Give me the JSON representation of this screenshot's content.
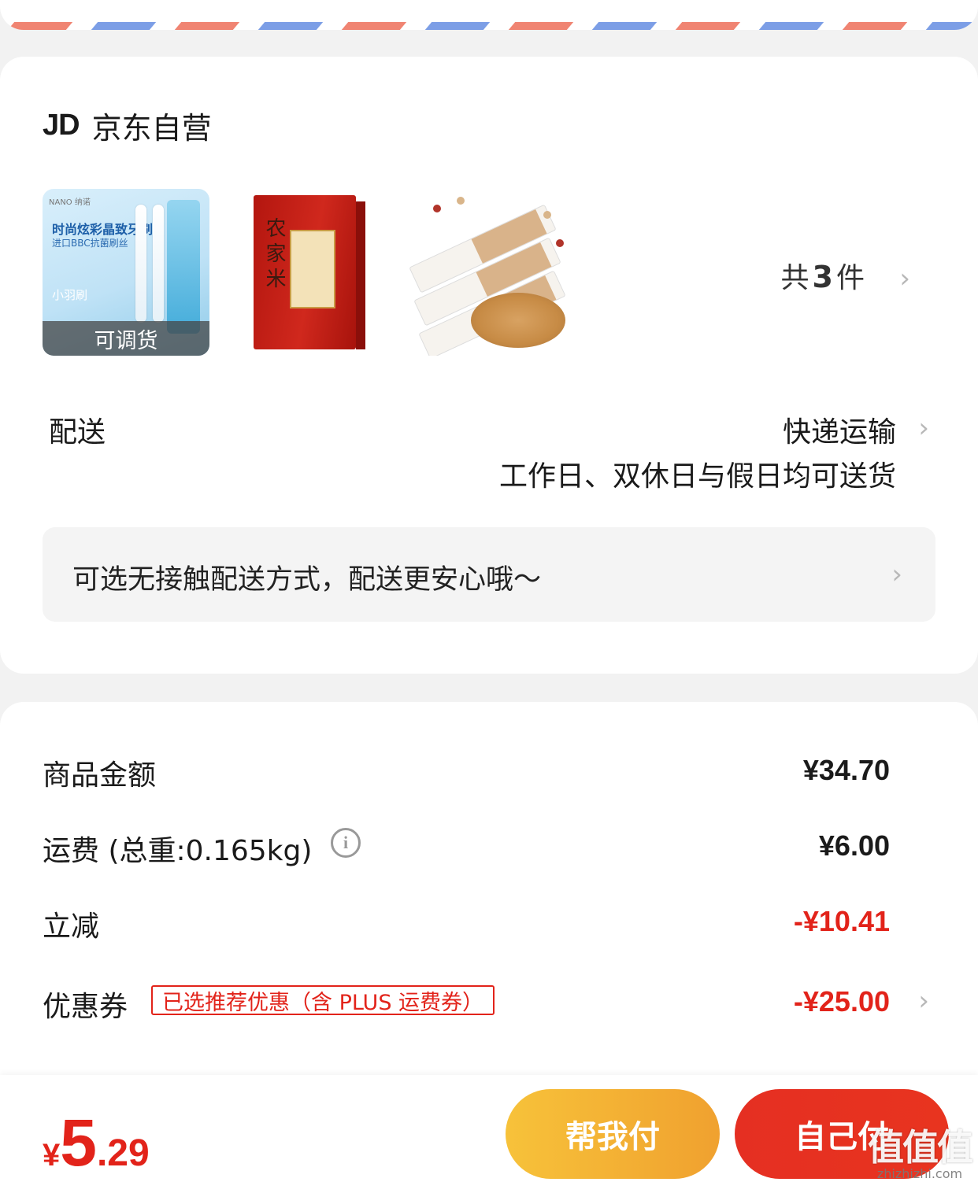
{
  "address_stripe": {
    "red": "#f08472",
    "blue": "#7c9ee6"
  },
  "store": {
    "logo_text": "JD",
    "name": "京东自营",
    "products": [
      {
        "icon": "toothbrush-product-image",
        "brand": "NANO 纳诺",
        "title": "时尚炫彩晶致牙刷",
        "subtitle": "进口BBC抗菌刷丝",
        "name": "小羽刷",
        "tag": "可调货"
      },
      {
        "icon": "rice-box-product-image",
        "box_text": "农家米"
      },
      {
        "icon": "peanut-snack-product-image"
      }
    ],
    "count_prefix": "共",
    "count": "3",
    "count_suffix": "件"
  },
  "delivery": {
    "label": "配送",
    "method": "快递运输",
    "note": "工作日、双休日与假日均可送货",
    "contactless": "可选无接触配送方式，配送更安心哦～"
  },
  "summary": {
    "goods_label": "商品金额",
    "goods_value": "¥34.70",
    "shipping_label": "运费 (总重:0.165kg)",
    "shipping_value": "¥6.00",
    "discount_label": "立减",
    "discount_value": "-¥10.41",
    "coupon_label": "优惠券",
    "coupon_tag": "已选推荐优惠（含 PLUS 运费券）",
    "coupon_value": "-¥25.00"
  },
  "bottom": {
    "currency": "¥",
    "total_int": "5",
    "total_dec": ".29",
    "help_pay": "帮我付",
    "self_pay": "自己付"
  },
  "watermark": {
    "glyphs": "值值值",
    "url": "zhizhizhi.com"
  },
  "colors": {
    "price_red": "#e2231a",
    "help_btn": "#f3b034",
    "pay_btn": "#e6311f"
  }
}
